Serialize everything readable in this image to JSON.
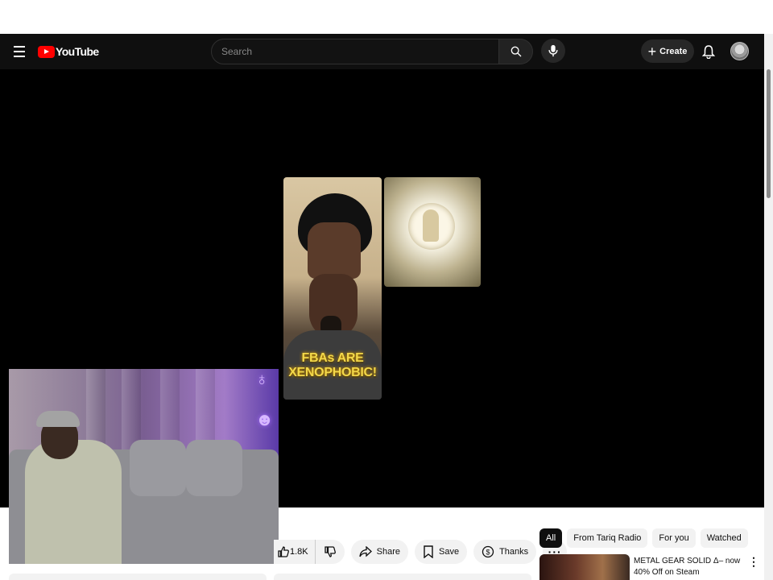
{
  "header": {
    "logo_text": "YouTube",
    "search_placeholder": "Search",
    "create_label": "Create"
  },
  "video": {
    "overlay_text": "FBAs ARE XENOPHOBIC!"
  },
  "actions": {
    "like_count": "1.8K",
    "share_label": "Share",
    "save_label": "Save",
    "thanks_label": "Thanks"
  },
  "chips": [
    {
      "label": "All",
      "active": true
    },
    {
      "label": "From Tariq Radio",
      "active": false
    },
    {
      "label": "For you",
      "active": false
    },
    {
      "label": "Watched",
      "active": false
    }
  ],
  "recommended": [
    {
      "title": "METAL GEAR SOLID Δ– now 40% Off on Steam"
    }
  ],
  "colors": {
    "topbar": "#0f0f0f",
    "brand_red": "#ff0000",
    "chip_active": "#0f0f0f",
    "chip_bg": "#f2f2f2"
  }
}
